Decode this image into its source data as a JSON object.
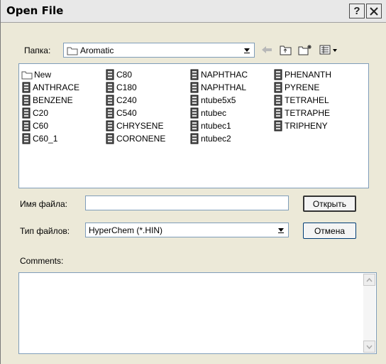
{
  "window": {
    "title": "Open File",
    "help_button": "?",
    "close_button": "✕"
  },
  "folder": {
    "label": "Папка:",
    "value": "Aromatic"
  },
  "toolbar": {
    "icons": [
      "back-arrow-icon",
      "up-folder-icon",
      "new-folder-icon",
      "view-menu-icon"
    ]
  },
  "files": {
    "columns": [
      [
        "New",
        "ANTHRACE",
        "BENZENE",
        "C20",
        "C60",
        "C60_1"
      ],
      [
        "C80",
        "C180",
        "C240",
        "C540",
        "CHRYSENE",
        "CORONENE"
      ],
      [
        "NAPHTHAC",
        "NAPHTHAL",
        "ntube5x5",
        "ntubec",
        "ntubec1",
        "ntubec2"
      ],
      [
        "PHENANTH",
        "PYRENE",
        "TETRAHEL",
        "TETRAPHE",
        "TRIPHENY"
      ]
    ]
  },
  "filename": {
    "label": "Имя файла:",
    "value": ""
  },
  "filetype": {
    "label": "Тип файлов:",
    "value": "HyperChem (*.HIN)"
  },
  "buttons": {
    "open": "Открыть",
    "cancel": "Отмена"
  },
  "comments": {
    "label": "Comments:",
    "value": ""
  }
}
